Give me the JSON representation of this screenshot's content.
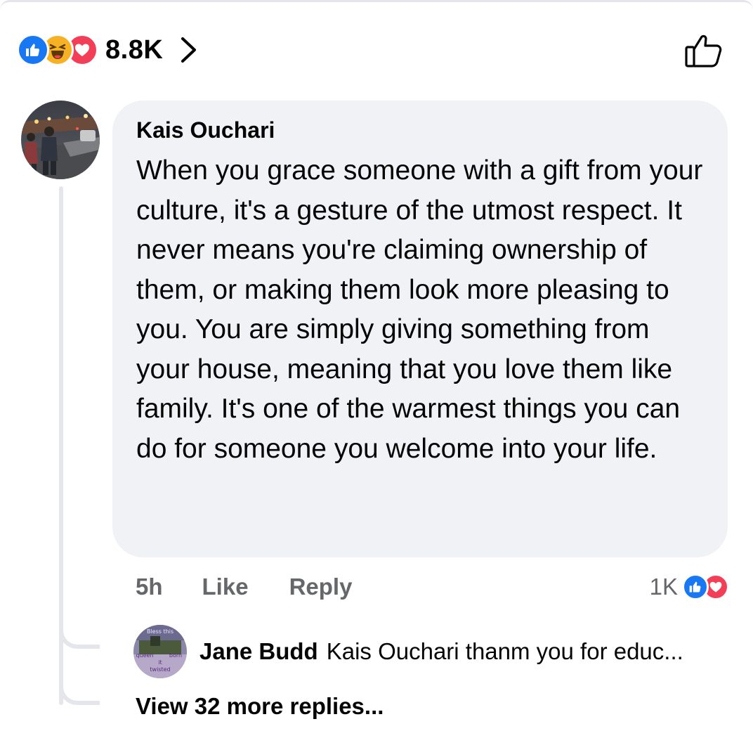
{
  "post_reactions": {
    "count": "8.8K",
    "icons": [
      "like-icon",
      "haha-icon",
      "love-icon"
    ]
  },
  "comment": {
    "author": "Kais Ouchari",
    "text": "When you grace someone with a gift from your culture, it's a gesture of the utmost respect. It never means you're claiming ownership of them, or making them look more pleasing to you. You are simply giving something from your house, meaning that you love them like family. It's one of the warmest things you can do for someone you welcome into your life.",
    "time": "5h",
    "like_label": "Like",
    "reply_label": "Reply",
    "reaction_count": "1K",
    "reaction_icons": [
      "like-icon",
      "love-icon"
    ]
  },
  "reply": {
    "author": "Jane Budd",
    "text": "Kais Ouchari thanm you for educ...",
    "avatar_text": [
      "Bless this",
      "queen",
      "born",
      "it",
      "twisted"
    ]
  },
  "view_more_label": "View 32 more replies...",
  "colors": {
    "like_blue": "#1877f2",
    "haha_yellow": "#f7b125",
    "love_red": "#f33e58",
    "bubble_bg": "#f0f2f5",
    "meta_gray": "#65676b"
  }
}
